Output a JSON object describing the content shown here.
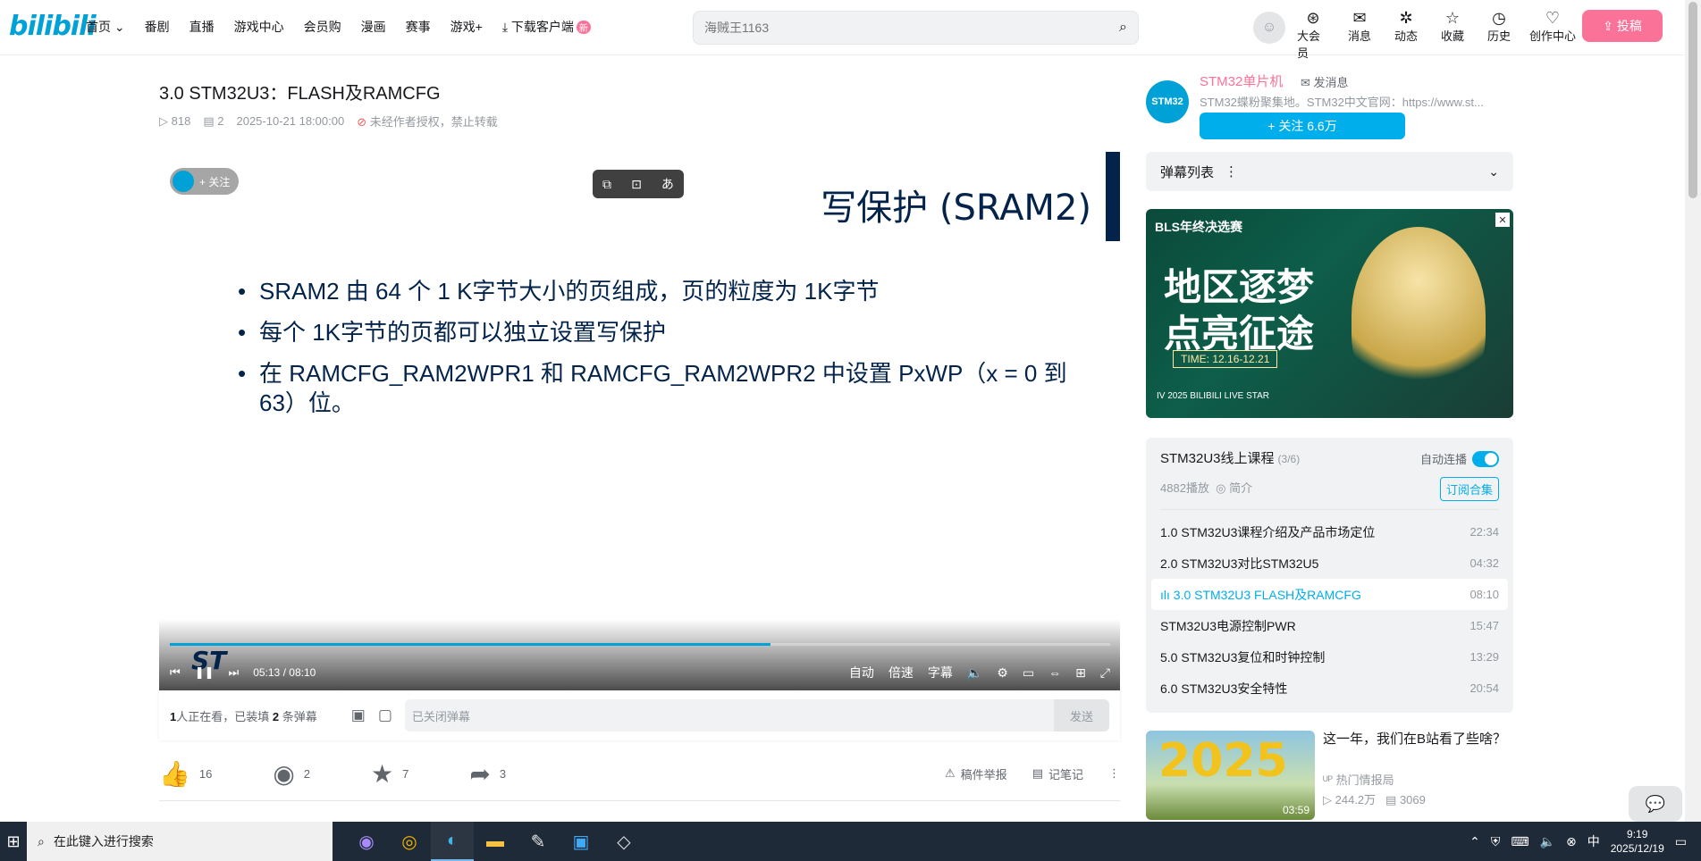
{
  "header": {
    "logo": "bilibili",
    "nav": [
      "首页",
      "番剧",
      "直播",
      "游戏中心",
      "会员购",
      "漫画",
      "赛事",
      "游戏+",
      "下载客户端"
    ],
    "nav_new_badge": "新",
    "search_placeholder": "海贼王1163",
    "icons": [
      {
        "label": "大会员",
        "glyph": "⊛"
      },
      {
        "label": "消息",
        "glyph": "✉"
      },
      {
        "label": "动态",
        "glyph": "✲"
      },
      {
        "label": "收藏",
        "glyph": "☆"
      },
      {
        "label": "历史",
        "glyph": "◷"
      },
      {
        "label": "创作中心",
        "glyph": "♡"
      }
    ],
    "upload": "投稿"
  },
  "video": {
    "title": "3.0 STM32U3：FLASH及RAMCFG",
    "views": "818",
    "danmaku_count": "2",
    "date": "2025-10-21 18:00:00",
    "notice": "未经作者授权，禁止转载"
  },
  "slide": {
    "title": "写保护 (SRAM2)",
    "bullets": [
      "SRAM2 由 64 个 1 K字节大小的页组成，页的粒度为 1K字节",
      "每个 1K字节的页都可以独立设置写保护",
      "在 RAMCFG_RAM2WPR1 和 RAMCFG_RAM2WPR2 中设置 PxWP（x = 0 到 63）位。"
    ],
    "brand": "ST"
  },
  "player": {
    "follow_chip": "+ 关注",
    "current_time": "05:13",
    "separator": "/",
    "total_time": "08:10",
    "progress_fraction": 0.639,
    "controls_right": [
      "自动",
      "倍速",
      "字幕"
    ]
  },
  "sendbar": {
    "viewers_count": "1",
    "viewers_text": "人正在看，已装填",
    "danmaku_loaded": "2",
    "danmaku_text": "条弹幕",
    "input_placeholder": "已关闭弹幕",
    "send": "发送"
  },
  "actions": {
    "like": "16",
    "coin": "2",
    "fav": "7",
    "share": "3",
    "report": "稿件举报",
    "notes": "记笔记"
  },
  "uploader": {
    "name": "STM32单片机",
    "msg": "发消息",
    "desc": "STM32蝶粉聚集地。STM32中文官网：https://www.st...",
    "follow": "+ 关注 6.6万",
    "avatar_text": "STM32"
  },
  "danmaku_list": {
    "title": "弹幕列表"
  },
  "ad": {
    "tag": "BLS年终决选赛",
    "line1": "地区逐梦",
    "line2": "点亮征途",
    "time": "TIME: 12.16-12.21",
    "year": "IV 2025 BILIBILI LIVE STAR"
  },
  "playlist": {
    "title": "STM32U3线上课程",
    "progress": "(3/6)",
    "autoplay": "自动连播",
    "plays": "4882播放",
    "intro": "简介",
    "subscribe": "订阅合集",
    "items": [
      {
        "title": "1.0 STM32U3课程介绍及产品市场定位",
        "dur": "22:34"
      },
      {
        "title": "2.0 STM32U3对比STM32U5",
        "dur": "04:32"
      },
      {
        "title": "3.0 STM32U3 FLASH及RAMCFG",
        "dur": "08:10"
      },
      {
        "title": "STM32U3电源控制PWR",
        "dur": "15:47"
      },
      {
        "title": "5.0 STM32U3复位和时钟控制",
        "dur": "13:29"
      },
      {
        "title": "6.0 STM32U3安全特性",
        "dur": "20:54"
      }
    ]
  },
  "recommend": {
    "thumb_text": "2025",
    "duration": "03:59",
    "title": "这一年，我们在B站看了些啥？",
    "uploader": "热门情报局",
    "views": "244.2万",
    "danmaku": "3069"
  },
  "taskbar": {
    "search": "在此键入进行搜索",
    "time": "9:19",
    "date": "2025/12/19"
  },
  "colors": {
    "brand": "#00a1d6",
    "pink": "#fb7299",
    "accent": "#00aeec",
    "slide": "#03234b"
  }
}
